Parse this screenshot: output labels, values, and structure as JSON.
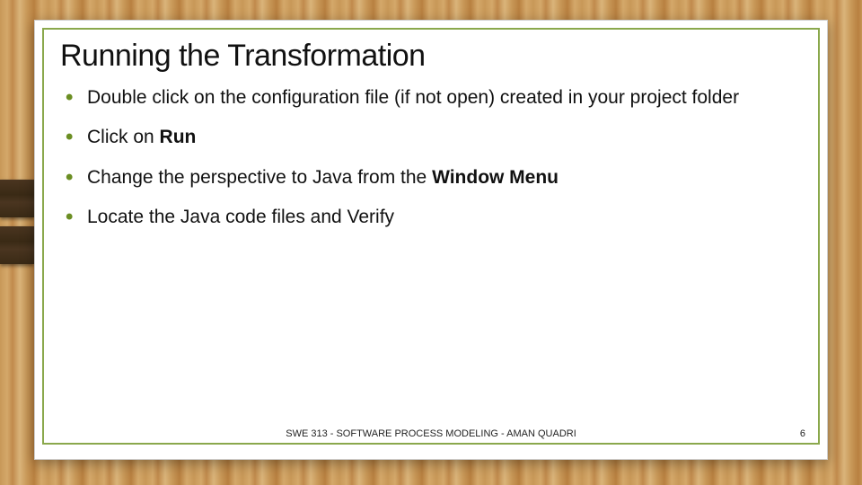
{
  "slide": {
    "title": "Running the Transformation",
    "bullets": [
      {
        "pre": "Double click on the configuration file (if not open) created in your project folder",
        "bold": "",
        "post": ""
      },
      {
        "pre": "Click on ",
        "bold": "Run",
        "post": ""
      },
      {
        "pre": "Change the perspective to Java from the ",
        "bold": "Window Menu",
        "post": ""
      },
      {
        "pre": "Locate the Java code files and Verify",
        "bold": "",
        "post": ""
      }
    ],
    "footer": "SWE 313 - SOFTWARE PROCESS MODELING - AMAN QUADRI",
    "page_number": "6"
  }
}
